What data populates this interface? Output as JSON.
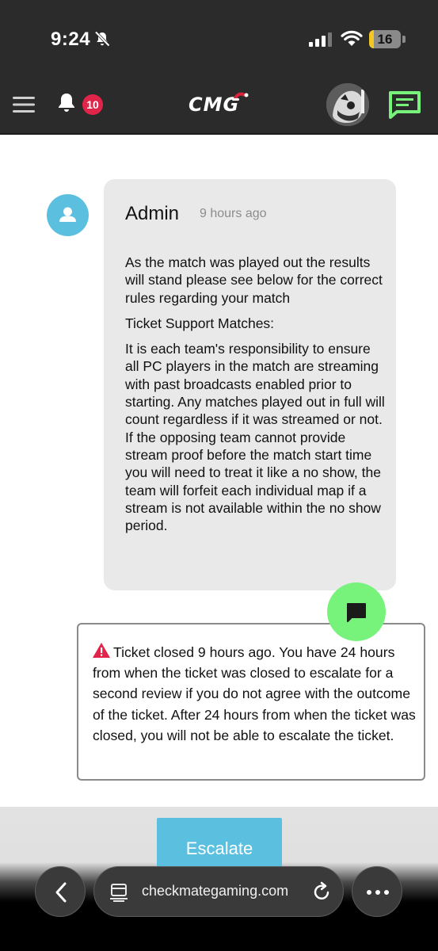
{
  "status_bar": {
    "time": "9:24",
    "battery_level": "16",
    "icons": [
      "bell-slash-icon",
      "signal-icon",
      "wifi-icon",
      "battery-icon"
    ]
  },
  "header": {
    "logo": "CMG",
    "notification_count": "10",
    "icons": [
      "menu-icon",
      "bell-icon",
      "avatar",
      "chat-icon"
    ],
    "chat_icon_color": "#77f27b",
    "badge_color": "#e0244a"
  },
  "message": {
    "author": "Admin",
    "time": "9 hours ago",
    "paragraphs": [
      "As the match was played out the results will stand please see below for the correct rules regarding your match",
      "Ticket Support Matches:",
      "It is each team's responsibility to ensure all PC players in the match are streaming with past broadcasts enabled prior to starting. Any matches played out in full will count regardless if it was streamed or not.\nIf the opposing team cannot provide stream proof before the match start time you will need to treat it like a no show, the team will forfeit each individual map if a stream is not available within the no show period."
    ]
  },
  "notice": {
    "text": "Ticket closed 9 hours ago. You have 24 hours from when the ticket was closed to escalate for a second review if you do not agree with the outcome of the ticket. After 24 hours from when the ticket was closed, you will not be able to escalate the ticket.",
    "icon": "warning-icon",
    "icon_color": "#e0244a"
  },
  "actions": {
    "escalate_label": "Escalate",
    "accent_color": "#5bc0e0"
  },
  "browser": {
    "url": "checkmategaming.com",
    "icons": [
      "back-icon",
      "page-icon",
      "reload-icon",
      "more-icon"
    ]
  }
}
